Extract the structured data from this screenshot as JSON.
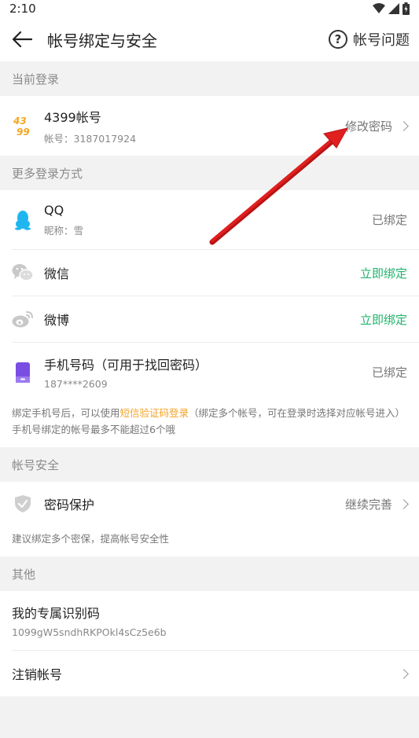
{
  "status": {
    "time": "2:10"
  },
  "nav": {
    "title": "帐号绑定与安全",
    "help_label": "帐号问题",
    "help_glyph": "?"
  },
  "sections": {
    "current": "当前登录",
    "more": "更多登录方式",
    "security": "帐号安全",
    "other": "其他"
  },
  "account_4399": {
    "logo_top": "43",
    "logo_bottom": "99",
    "title": "4399帐号",
    "sub": "帐号：3187017924",
    "action": "修改密码"
  },
  "qq": {
    "title": "QQ",
    "sub": "昵称：雪",
    "status": "已绑定"
  },
  "wechat": {
    "title": "微信",
    "status": "立即绑定"
  },
  "weibo": {
    "title": "微博",
    "status": "立即绑定"
  },
  "phone": {
    "title": "手机号码（可用于找回密码）",
    "sub": "187****2609",
    "status": "已绑定"
  },
  "phone_note": {
    "part1": "绑定手机号后，可以使用",
    "link": "短信验证码登录",
    "part2": "（绑定多个帐号，可在登录时选择对应帐号进入）",
    "line2": "手机号绑定的帐号最多不能超过6个哦"
  },
  "pwd_protect": {
    "title": "密码保护",
    "action": "继续完善",
    "note": "建议绑定多个密保，提高帐号安全性"
  },
  "unique_code": {
    "title": "我的专属识别码",
    "value": "1099gW5sndhRKPOkl4sCz5e6b"
  },
  "cancel_account": {
    "title": "注销帐号"
  },
  "colors": {
    "accent_green": "#22b36b",
    "link_orange": "#f2a42a",
    "arrow_red": "#e01f1f"
  }
}
